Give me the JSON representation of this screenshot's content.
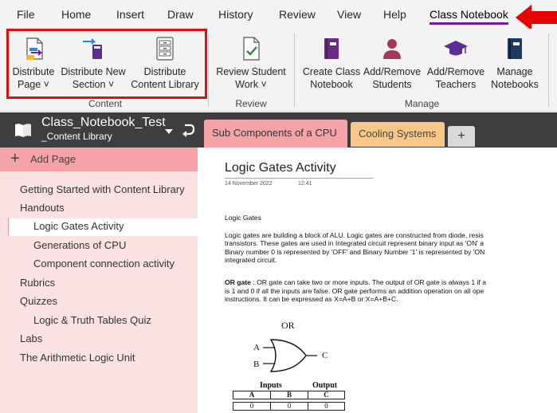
{
  "menubar": {
    "items": [
      "File",
      "Home",
      "Insert",
      "Draw",
      "History",
      "Review",
      "View",
      "Help",
      "Class Notebook"
    ],
    "active": "Class Notebook"
  },
  "ribbon": {
    "content_group": {
      "label": "Content",
      "buttons": [
        {
          "line1": "Distribute",
          "line2": "Page ˅"
        },
        {
          "line1": "Distribute New",
          "line2": "Section ˅"
        },
        {
          "line1": "Distribute",
          "line2": "Content Library"
        }
      ]
    },
    "review_group": {
      "label": "Review",
      "buttons": [
        {
          "line1": "Review Student",
          "line2": "Work ˅"
        }
      ]
    },
    "manage_group": {
      "label": "Manage",
      "buttons": [
        {
          "line1": "Create Class",
          "line2": "Notebook"
        },
        {
          "line1": "Add/Remove",
          "line2": "Students"
        },
        {
          "line1": "Add/Remove",
          "line2": "Teachers"
        },
        {
          "line1": "Manage",
          "line2": "Notebooks"
        }
      ]
    }
  },
  "notebook": {
    "title": "Class_Notebook_Test",
    "section": "_Content Library"
  },
  "tabs": [
    "Sub Components of a CPU",
    "Cooling Systems",
    "+"
  ],
  "pages": {
    "add_label": "Add Page",
    "items": [
      {
        "label": "Getting Started with Content Library",
        "level": 0
      },
      {
        "label": "Handouts",
        "level": 0
      },
      {
        "label": "Logic Gates Activity",
        "level": 1,
        "selected": true
      },
      {
        "label": "Generations of CPU",
        "level": 1
      },
      {
        "label": "Component connection activity",
        "level": 1
      },
      {
        "label": "Rubrics",
        "level": 0
      },
      {
        "label": "Quizzes",
        "level": 0
      },
      {
        "label": "Logic & Truth Tables Quiz",
        "level": 1
      },
      {
        "label": "Labs",
        "level": 0
      },
      {
        "label": "The Arithmetic Logic Unit",
        "level": 0
      }
    ]
  },
  "page": {
    "title": "Logic Gates Activity",
    "date": "14 November 2022",
    "time": "12:41",
    "heading": "Logic Gates",
    "para1": [
      "Logic gates are building a block of ALU. Logic gates are constructed from diode, resis",
      "transistors. These gates are used in Integrated circuit represent binary input as 'ON' a",
      "Binary number 0 is represented by 'OFF' and Binary Number '1' is represented by 'ON",
      "integrated circuit."
    ],
    "or_label": "OR gate",
    "para2": [
      ": OR gate can take two or more inputs. The output of OR gate is always 1 if a",
      "is 1 and 0 if all the inputs are false. OR gate performs an addition operation on all ope",
      "instructions. It can be expressed as X=A+B or X=A+B+C."
    ],
    "diagram_title": "OR",
    "input_a": "A",
    "input_b": "B",
    "output_c": "C",
    "table": {
      "inputs_header": "Inputs",
      "output_header": "Output",
      "columns": [
        "A",
        "B",
        "C"
      ],
      "rows": [
        [
          "0",
          "0",
          "0"
        ]
      ]
    }
  },
  "colors": {
    "accent": "#7719aa",
    "highlight": "#e01010",
    "section_tab": "#f5a3a8",
    "cooling_tab": "#f7c88a",
    "pane_bg": "#fce2e3"
  }
}
